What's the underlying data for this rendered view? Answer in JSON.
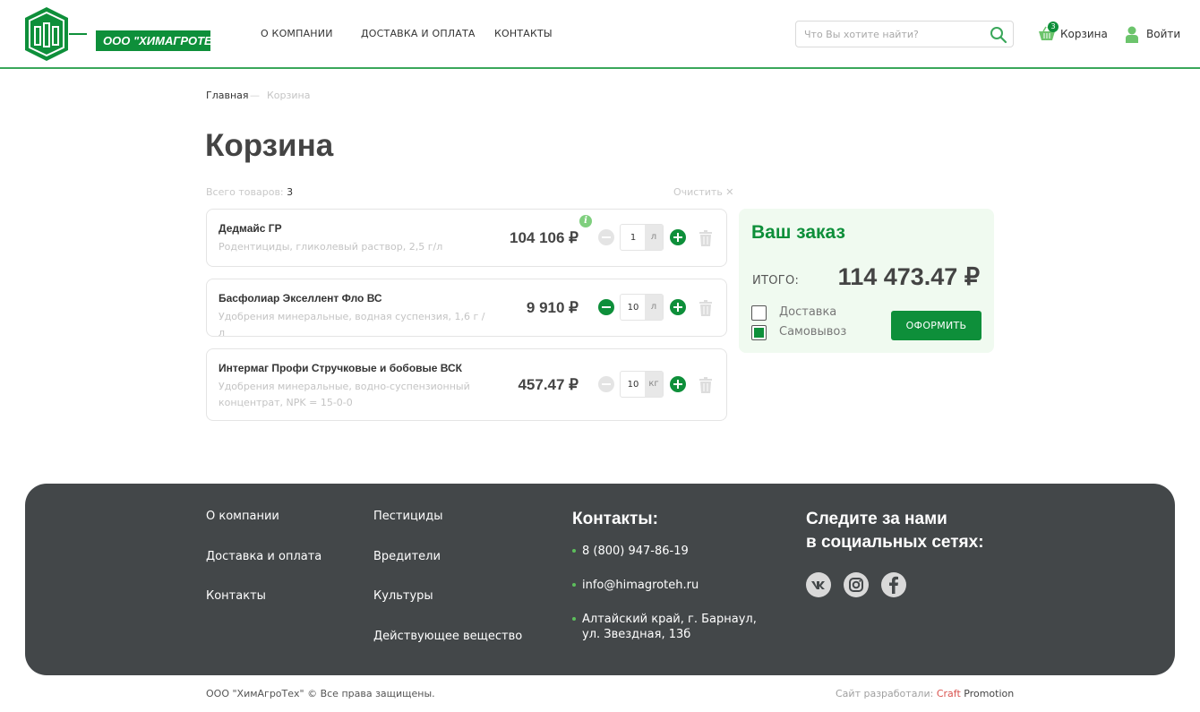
{
  "header": {
    "logo_text": "ООО \"ХИМАГРОТЕХ\"",
    "nav": [
      "О КОМПАНИИ",
      "ДОСТАВКА И ОПЛАТА",
      "КОНТАКТЫ"
    ],
    "search_placeholder": "Что Вы хотите найти?",
    "cart_count": "3",
    "cart_label": "Корзина",
    "login_label": "Войти"
  },
  "breadcrumb": {
    "home": "Главная",
    "separator": "—",
    "current": "Корзина"
  },
  "page_title": "Корзина",
  "summary": {
    "count_label": "Всего товаров:",
    "count": "3",
    "clear_label": "Очистить ✕"
  },
  "items": [
    {
      "name": "Дедмайс ГР",
      "desc": "Родентициды, гликолевый раствор, 2,5 г/л",
      "price": "104 106 ₽",
      "qty": "1",
      "unit": "л"
    },
    {
      "name": "Басфолиар Экселлент Фло ВС",
      "desc": "Удобрения минеральные, водная суспензия, 1,6 г / л",
      "price": "9 910 ₽",
      "qty": "10",
      "unit": "л"
    },
    {
      "name": "Интермаг Профи Стручковые и бобовые ВСК",
      "desc": "Удобрения минеральные, водно-суспензионный концентрат, NPK = 15-0-0",
      "price": "457.47 ₽",
      "qty": "10",
      "unit": "кг"
    }
  ],
  "info_glyph": "i",
  "order": {
    "title": "Ваш заказ",
    "total_label": "ИТОГО:",
    "total": "114 473.47 ₽",
    "options": [
      "Доставка",
      "Самовывоз"
    ],
    "checkout_label": "ОФОРМИТЬ"
  },
  "footer": {
    "col1": [
      "О компании",
      "Доставка и оплата",
      "Контакты"
    ],
    "col2": [
      "Пестициды",
      "Вредители",
      "Культуры",
      "Действующее вещество"
    ],
    "contacts_title": "Контакты:",
    "phone": "8 (800) 947-86-19",
    "email": "info@himagroteh.ru",
    "address_line1": "Алтайский край, г. Барнаул,",
    "address_line2": "ул. Звездная, 13б",
    "social_title_line1": "Следите за нами",
    "social_title_line2": "в социальных сетях:",
    "social_icons": [
      "vk-icon",
      "instagram-icon",
      "facebook-icon"
    ]
  },
  "bottom": {
    "copyright": "ООО \"ХимАгроТех\" © Все права защищены.",
    "dev_prefix": "Сайт разработали:",
    "dev_craft": "Craft",
    "dev_promo": "Promotion"
  },
  "colors": {
    "brand_green": "#0e8f3a",
    "footer_bg": "#434749",
    "panel_bg": "#f0faf0"
  }
}
